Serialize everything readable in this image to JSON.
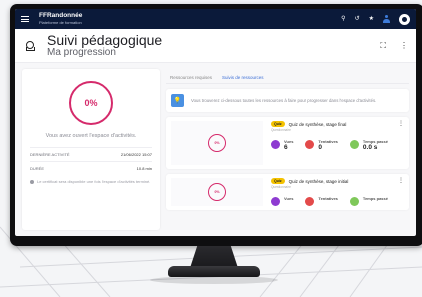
{
  "app": {
    "brand_title": "FFRandonnée",
    "brand_subtitle": "Plateforme de formation"
  },
  "topbar_icons": [
    "search-icon",
    "history-icon",
    "star-icon",
    "user-icon",
    "avatar"
  ],
  "page": {
    "title": "Suivi pédagogique",
    "subtitle": "Ma progression"
  },
  "summary": {
    "percent": "0%",
    "message": "Vous avez ouvert l'espace d'activités.",
    "rows": [
      {
        "label": "DERNIÈRE ACTIVITÉ",
        "value": "21/06/2022 15:07"
      },
      {
        "label": "DURÉE",
        "value": "10.8 min"
      }
    ],
    "note": "Le certificat sera disponible une fois l'espace d'activités terminé."
  },
  "tabs": [
    {
      "label": "Ressources requises",
      "active": false
    },
    {
      "label": "Suivis de ressources",
      "active": true
    }
  ],
  "banner": {
    "text": "Vous trouverez ci-dessous toutes les ressources à faire pour progresser dans l'espace d'activités."
  },
  "activities": [
    {
      "badge": "Quiz",
      "title": "Quiz de synthèse, stage final",
      "subtitle": "Questionnaire",
      "percent": "0%",
      "stats": [
        {
          "label": "Vues",
          "value": "6",
          "color": "#8e3bd1"
        },
        {
          "label": "Tentatives",
          "value": "0",
          "color": "#e34a4a"
        },
        {
          "label": "Temps passé",
          "value": "0.0 s",
          "color": "#7fc85a"
        }
      ]
    },
    {
      "badge": "Quiz",
      "title": "Quiz de synthèse, stage initial",
      "subtitle": "Questionnaire",
      "percent": "0%",
      "stats": [
        {
          "label": "Vues",
          "value": "",
          "color": "#8e3bd1"
        },
        {
          "label": "Tentatives",
          "value": "",
          "color": "#e34a4a"
        },
        {
          "label": "Temps passé",
          "value": "",
          "color": "#7fc85a"
        }
      ]
    }
  ]
}
